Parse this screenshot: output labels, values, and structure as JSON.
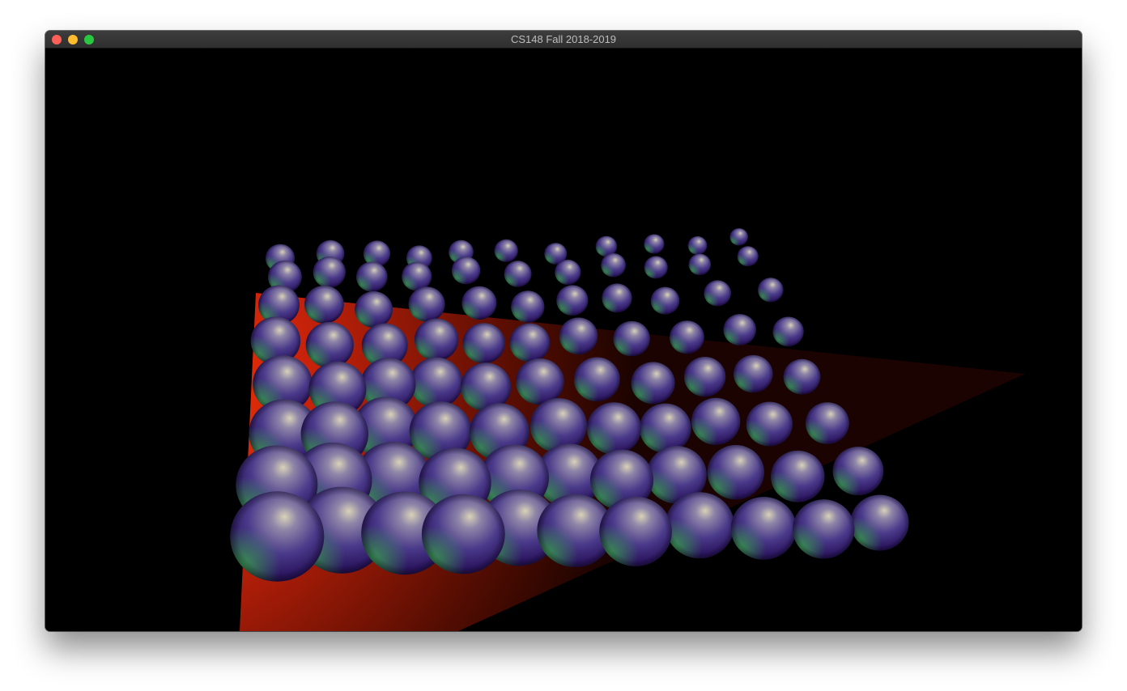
{
  "window": {
    "title": "CS148 Fall 2018-2019",
    "controls": [
      {
        "name": "close-button",
        "color": "#fe5f57"
      },
      {
        "name": "minimize-button",
        "color": "#febc2e"
      },
      {
        "name": "zoom-button",
        "color": "#28c840"
      }
    ]
  },
  "scene": {
    "background_color": "#000000",
    "floor_color": "#d42a08",
    "sphere_base_color": "#3a1f7a"
  }
}
